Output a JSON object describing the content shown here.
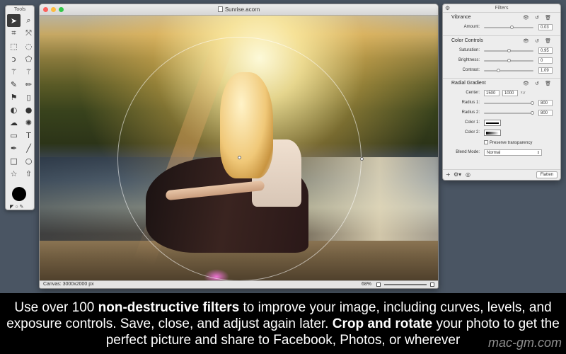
{
  "tools": {
    "title": "Tools",
    "items": [
      {
        "icon": "arrow-select-icon",
        "glyph": "➤"
      },
      {
        "icon": "zoom-icon",
        "glyph": "⌕"
      },
      {
        "icon": "crop-icon",
        "glyph": "⌗"
      },
      {
        "icon": "move-icon",
        "glyph": "⤧"
      },
      {
        "icon": "rect-select-icon",
        "glyph": "⬚"
      },
      {
        "icon": "ellipse-select-icon",
        "glyph": "◌"
      },
      {
        "icon": "lasso-icon",
        "glyph": "ↄ"
      },
      {
        "icon": "poly-lasso-icon",
        "glyph": "⬠"
      },
      {
        "icon": "magic-wand-icon",
        "glyph": "⚚"
      },
      {
        "icon": "magic-wand-2-icon",
        "glyph": "⚚"
      },
      {
        "icon": "brush-icon",
        "glyph": "✎"
      },
      {
        "icon": "pencil-icon",
        "glyph": "✏"
      },
      {
        "icon": "stamp-icon",
        "glyph": "⚑"
      },
      {
        "icon": "eraser-icon",
        "glyph": "▯"
      },
      {
        "icon": "dodge-icon",
        "glyph": "◐"
      },
      {
        "icon": "blur-icon",
        "glyph": "●"
      },
      {
        "icon": "cloud-icon",
        "glyph": "☁"
      },
      {
        "icon": "sun-icon",
        "glyph": "✺"
      },
      {
        "icon": "gradient-icon",
        "glyph": "▭"
      },
      {
        "icon": "text-icon",
        "glyph": "T"
      },
      {
        "icon": "pen-icon",
        "glyph": "✒"
      },
      {
        "icon": "line-icon",
        "glyph": "╱"
      },
      {
        "icon": "rectangle-icon",
        "glyph": "□"
      },
      {
        "icon": "circle-icon",
        "glyph": "○"
      },
      {
        "icon": "star-icon",
        "glyph": "☆"
      },
      {
        "icon": "arrow-shape-icon",
        "glyph": "⇧"
      }
    ],
    "primary_color": "#000000",
    "swatch_glyphs": "◤ ○ ✎"
  },
  "document": {
    "title": "Sunrise.acorn",
    "status_canvas": "Canvas: 3000x2000 px",
    "zoom": "68%"
  },
  "filters": {
    "title": "Filters",
    "vibrance": {
      "name": "Vibrance",
      "rows": [
        {
          "label": "Amount:",
          "value": "0.03",
          "level": 0.55
        }
      ]
    },
    "color_controls": {
      "name": "Color Controls",
      "rows": [
        {
          "label": "Saturation:",
          "value": "0.95",
          "level": 0.5
        },
        {
          "label": "Brightness:",
          "value": "0",
          "level": 0.5
        },
        {
          "label": "Contrast:",
          "value": "1.09",
          "level": 0.28
        }
      ]
    },
    "radial_gradient": {
      "name": "Radial Gradient",
      "center_label": "Center:",
      "center_x": "1500",
      "center_y": "1000",
      "center_xy": "x,y",
      "rows": [
        {
          "label": "Radius 1:",
          "value": "800",
          "level": 0.97
        },
        {
          "label": "Radius 2:",
          "value": "800",
          "level": 0.97
        }
      ],
      "color1_label": "Color 1:",
      "color2_label": "Color 2:",
      "preserve_label": "Preserve transparency",
      "blend_label": "Blend Mode:",
      "blend_value": "Normal"
    },
    "flatten_label": "Flatten",
    "section_icons": "👁 ↺ 🗑"
  },
  "caption": {
    "part1": "Use over 100 ",
    "bold1": "non-destructive filters",
    "part2": " to improve your image, including curves, levels, and exposure controls. Save, close, and adjust again later. ",
    "bold2": "Crop and rotate",
    "part3": " your photo to get the perfect picture and share to Facebook, Photos, or wherever",
    "watermark": "mac-gm.com"
  }
}
